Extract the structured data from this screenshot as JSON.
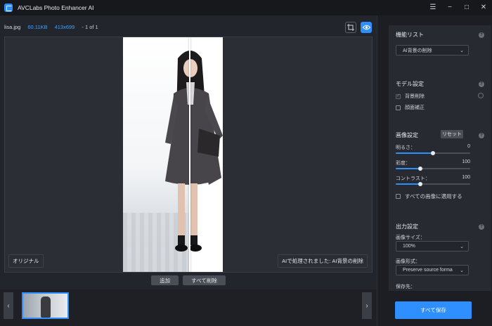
{
  "app": {
    "title": "AVCLabs Photo Enhancer AI"
  },
  "window_controls": {
    "menu": "☰",
    "minimize": "−",
    "maximize": "□",
    "close": "✕"
  },
  "file": {
    "name": "lisa.jpg",
    "size": "60.11KB",
    "dimensions": "413x699",
    "counter": "- 1 of 1"
  },
  "toolbar": {
    "crop_icon": "crop-icon",
    "preview_icon": "eye-icon"
  },
  "preview": {
    "original_label": "オリジナル",
    "processed_label": "AIで処理されました: AI背景の削除",
    "divider_position": 0.66
  },
  "queue": {
    "add_label": "追加",
    "delete_all_label": "すべて削除",
    "prev": "‹",
    "next": "›"
  },
  "panel": {
    "features": {
      "title": "機能リスト",
      "selected": "AI背景の削除"
    },
    "model": {
      "title": "モデル設定",
      "options": [
        {
          "label": "背景削除",
          "checked": true
        },
        {
          "label": "顔面補正",
          "checked": false
        }
      ]
    },
    "image": {
      "title": "画像設定",
      "reset_label": "リセット",
      "sliders": [
        {
          "label": "明るさ：",
          "value": "0",
          "fraction": 0.5
        },
        {
          "label": "彩度：",
          "value": "100",
          "fraction": 0.33
        },
        {
          "label": "コントラスト：",
          "value": "100",
          "fraction": 0.33
        }
      ],
      "apply_all_label": "すべての画像に適用する"
    },
    "output": {
      "title": "出力設定",
      "size_label": "画像サイズ：",
      "size_value": "100%",
      "format_label": "画像形式：",
      "format_value": "Preserve source forma",
      "dest_label": "保存先："
    },
    "save_all_label": "すべて保存"
  },
  "colors": {
    "accent": "#2f8fff",
    "panel": "#272a31",
    "bg": "#22252b"
  }
}
